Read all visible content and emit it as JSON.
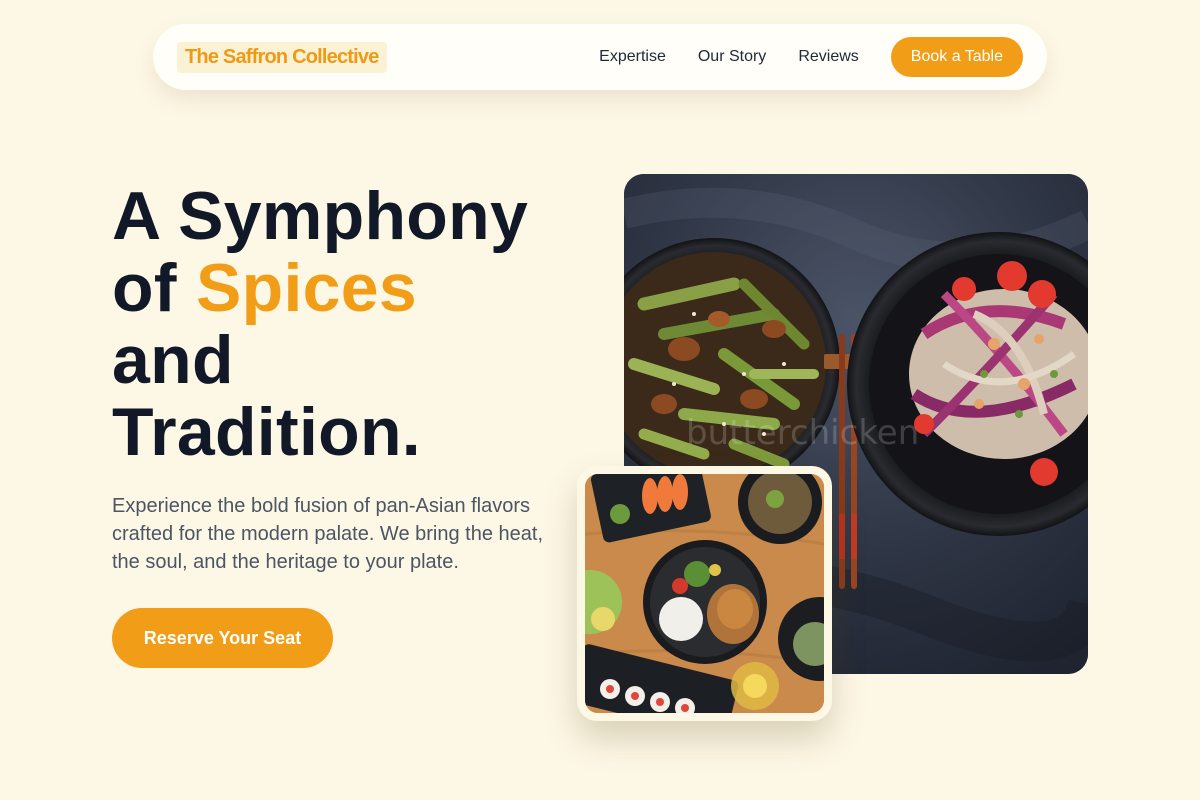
{
  "nav": {
    "brand": "The Saffron Collective",
    "links": [
      "Expertise",
      "Our Story",
      "Reviews"
    ],
    "cta_label": "Book a Table"
  },
  "hero": {
    "title_line1": "A Symphony",
    "title_of": "of",
    "title_accent": "Spices",
    "title_line3": "and",
    "title_line4": "Tradition.",
    "subtitle": "Experience the bold fusion of pan-Asian flavors crafted for the modern palate. We bring the heat, the soul, and the heritage to your plate.",
    "cta_label": "Reserve Your Seat"
  },
  "images": {
    "main_photo_watermark": "butterchicken",
    "main_photo_subject": "two-bowls-with-chopsticks",
    "secondary_photo_subject": "asian-dishes-table-spread"
  },
  "colors": {
    "accent": "#f29d17",
    "background": "#fdf8e6",
    "heading": "#111827",
    "body_text": "#4b5563"
  }
}
